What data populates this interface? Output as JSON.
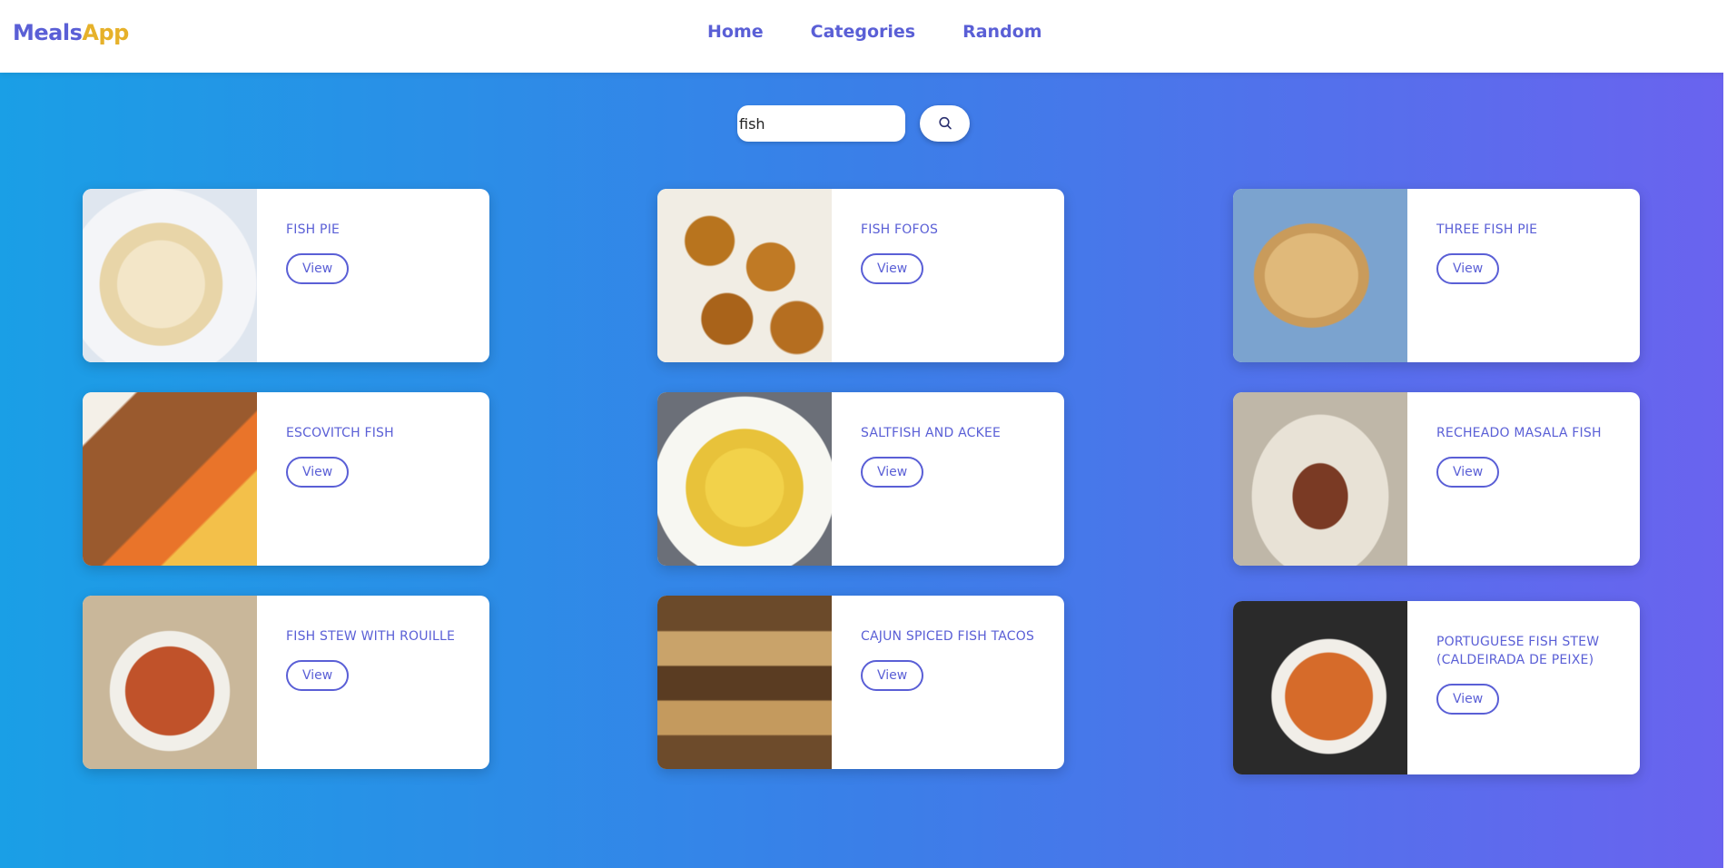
{
  "navbar": {
    "brand_part1": "Meals",
    "brand_part2": "App",
    "links": [
      "Home",
      "Categories",
      "Random"
    ]
  },
  "search": {
    "value": "fish",
    "button_icon": "search-icon"
  },
  "meals": [
    {
      "title": "FISH PIE",
      "button": "View",
      "image": "fish-pie-photo"
    },
    {
      "title": "FISH FOFOS",
      "button": "View",
      "image": "fish-fofos-photo"
    },
    {
      "title": "THREE FISH PIE",
      "button": "View",
      "image": "three-fish-pie-photo"
    },
    {
      "title": "ESCOVITCH FISH",
      "button": "View",
      "image": "escovitch-fish-photo"
    },
    {
      "title": "SALTFISH AND ACKEE",
      "button": "View",
      "image": "saltfish-ackee-photo"
    },
    {
      "title": "RECHEADO MASALA FISH",
      "button": "View",
      "image": "recheado-masala-fish-photo"
    },
    {
      "title": "FISH STEW WITH ROUILLE",
      "button": "View",
      "image": "fish-stew-rouille-photo"
    },
    {
      "title": "CAJUN SPICED FISH TACOS",
      "button": "View",
      "image": "cajun-fish-tacos-photo"
    },
    {
      "title": "PORTUGUESE FISH STEW (CALDEIRADA DE PEIXE)",
      "button": "View",
      "image": "portuguese-fish-stew-photo"
    }
  ],
  "colors": {
    "accent": "#5a5fd6",
    "brand_secondary": "#e6b12a",
    "background_start": "#1a9fe6",
    "background_end": "#6a63ef"
  }
}
